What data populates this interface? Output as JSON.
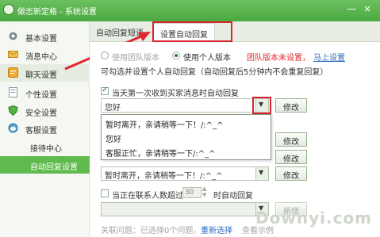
{
  "window": {
    "title": "做志新定格 - 系统设置",
    "minimize": "—",
    "close": "×"
  },
  "sidebar": {
    "items": [
      {
        "label": "基本设置",
        "icon": "gear-icon"
      },
      {
        "label": "消息中心",
        "icon": "mail-icon"
      },
      {
        "label": "聊天设置",
        "icon": "chat-icon"
      },
      {
        "label": "个性设置",
        "icon": "doc-icon"
      },
      {
        "label": "安全设置",
        "icon": "shield-icon"
      },
      {
        "label": "客服设置",
        "icon": "service-icon"
      }
    ],
    "subitems": [
      {
        "label": "接待中心"
      },
      {
        "label": "自动回复设置"
      }
    ]
  },
  "tabs": [
    {
      "label": "自动回复短语"
    },
    {
      "label": "设置自动回复"
    }
  ],
  "content": {
    "version_team": "使用团队版本",
    "version_personal": "使用个人版本",
    "version_team_unset": "团队版本未设置，",
    "set_now": "马上设置",
    "desc": "可勾选并设置个人自动回复（自动回复后5分钟内不会重复回复）",
    "first_msg_label": "当天第一次收到买家消息时自动回复",
    "first_msg_value": "您好",
    "modify": "修改",
    "dropdown_options": [
      "暂时离开，亲请稍等一下！/:^_^",
      "您好",
      "客服正忙，亲请稍等一下/:^_^"
    ],
    "third_value": "暂时离开，亲请稍等一下！/:^_^",
    "contact_limit_prefix": "当正在联系人数超过",
    "contact_limit_value": "30",
    "contact_limit_suffix": "时自动回复",
    "new": "新增",
    "related_prefix": "关联问题：已选择0个问题，",
    "reselect": "重新选择",
    "view_example": "查看示例"
  },
  "colors": {
    "title_green": "#4aa83f",
    "highlight_red": "#d9232d",
    "selected_green": "#5fbb4d"
  },
  "watermark": "Downyi.com"
}
